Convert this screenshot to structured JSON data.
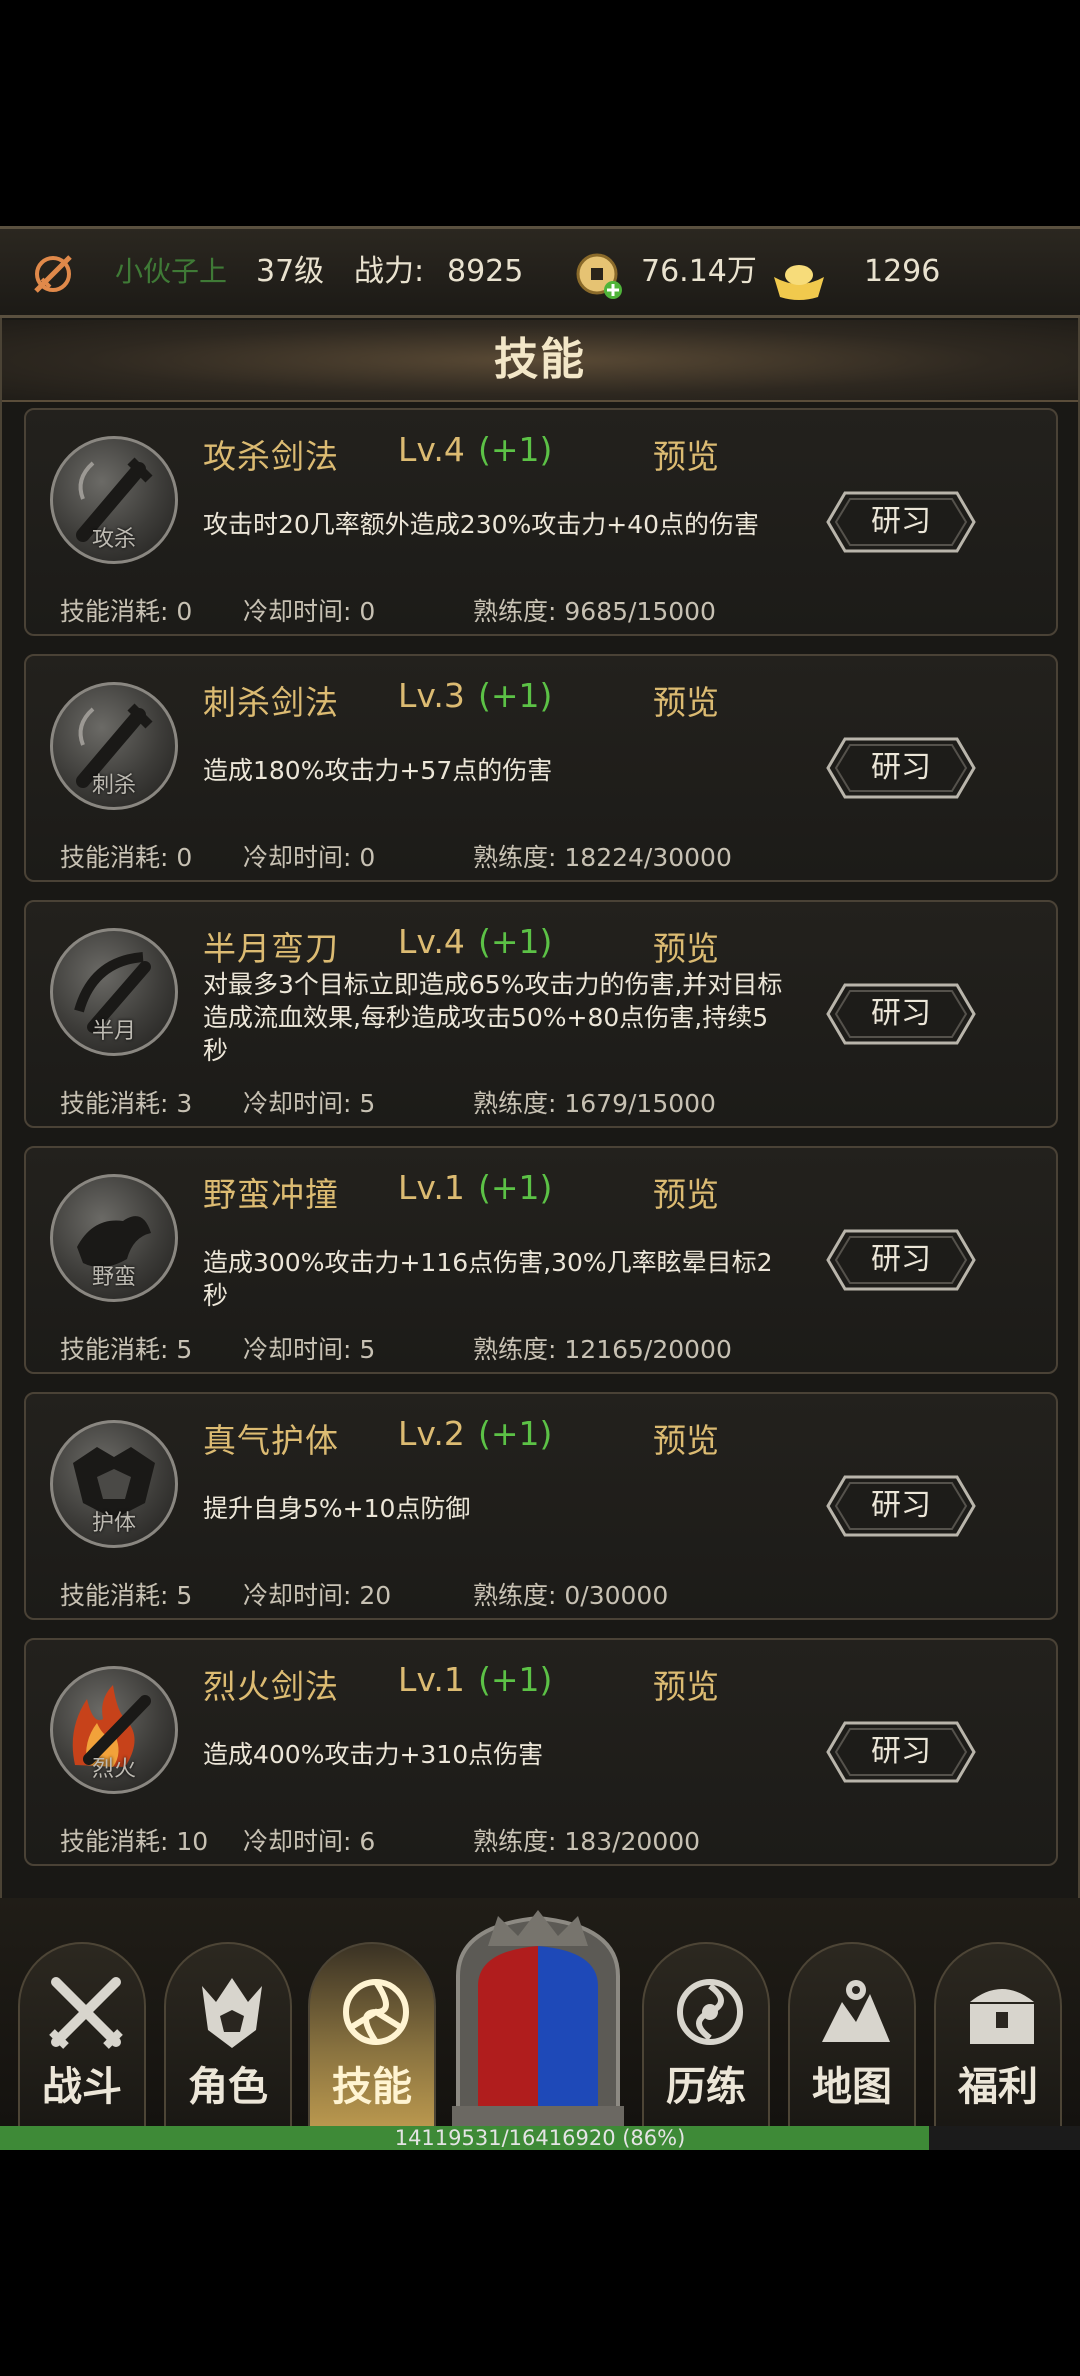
{
  "header": {
    "player_name": "小伙子上",
    "level": "37级",
    "power_label": "战力:",
    "power_value": "8925",
    "coins": "76.14万",
    "ingots": "1296"
  },
  "panel": {
    "title": "技能",
    "cost_label": "技能消耗:",
    "cooldown_label": "冷却时间:",
    "proficiency_label": "熟练度:",
    "research_label": "研习",
    "preview_label": "预览"
  },
  "skills": [
    {
      "icon_text": "攻杀",
      "icon": "sword-icon",
      "name": "攻杀剑法",
      "level": "Lv.4",
      "bonus": "(+1)",
      "desc": "攻击时20几率额外造成230%攻击力+40点的伤害",
      "cost": "0",
      "cooldown": "0",
      "proficiency": "9685/15000"
    },
    {
      "icon_text": "刺杀",
      "icon": "sword-icon",
      "name": "刺杀剑法",
      "level": "Lv.3",
      "bonus": "(+1)",
      "desc": "造成180%攻击力+57点的伤害",
      "cost": "0",
      "cooldown": "0",
      "proficiency": "18224/30000"
    },
    {
      "icon_text": "半月",
      "icon": "crescent-blade-icon",
      "name": "半月弯刀",
      "level": "Lv.4",
      "bonus": "(+1)",
      "desc": "对最多3个目标立即造成65%攻击力的伤害,并对目标造成流血效果,每秒造成攻击50%+80点伤害,持续5秒",
      "cost": "3",
      "cooldown": "5",
      "proficiency": "1679/15000"
    },
    {
      "icon_text": "野蛮",
      "icon": "charge-icon",
      "name": "野蛮冲撞",
      "level": "Lv.1",
      "bonus": "(+1)",
      "desc": "造成300%攻击力+116点伤害,30%几率眩晕目标2秒",
      "cost": "5",
      "cooldown": "5",
      "proficiency": "12165/20000"
    },
    {
      "icon_text": "护体",
      "icon": "shield-armor-icon",
      "name": "真气护体",
      "level": "Lv.2",
      "bonus": "(+1)",
      "desc": "提升自身5%+10点防御",
      "cost": "5",
      "cooldown": "20",
      "proficiency": "0/30000"
    },
    {
      "icon_text": "烈火",
      "icon": "flame-sword-icon",
      "name": "烈火剑法",
      "level": "Lv.1",
      "bonus": "(+1)",
      "desc": "造成400%攻击力+310点伤害",
      "cost": "10",
      "cooldown": "6",
      "proficiency": "183/20000"
    }
  ],
  "nav": [
    {
      "label": "战斗",
      "icon": "crossed-swords-icon"
    },
    {
      "label": "角色",
      "icon": "helmet-icon"
    },
    {
      "label": "技能",
      "icon": "triskele-icon",
      "active": true
    },
    {
      "label": "历练",
      "icon": "swirl-icon"
    },
    {
      "label": "地图",
      "icon": "map-icon"
    },
    {
      "label": "福利",
      "icon": "treasure-chest-icon"
    }
  ],
  "xp": {
    "text": "14119531/16416920 (86%)",
    "fraction": 0.86
  },
  "colors": {
    "gold": "#dcbb72",
    "green": "#5cc246",
    "name_green": "#3f7a36",
    "xp_green": "#3e8a37"
  }
}
